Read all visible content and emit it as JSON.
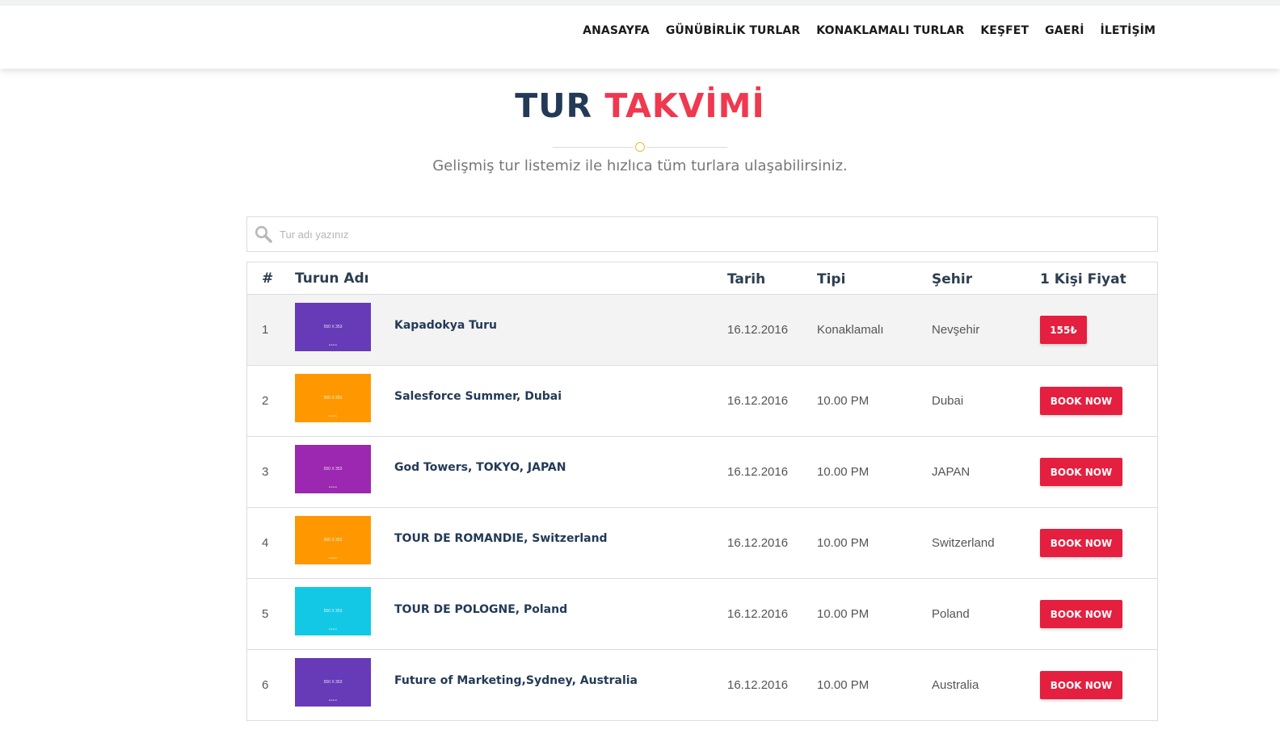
{
  "nav": {
    "items": [
      "ANASAYFA",
      "GÜNÜBİRLİK TURLAR",
      "KONAKLAMALI TURLAR",
      "KEŞFET",
      "GAERİ",
      "İLETİŞİM"
    ]
  },
  "heading": {
    "title_dark": "TUR",
    "title_accent": "TAKVİMİ",
    "subtitle": "Gelişmiş tur listemiz ile hızlıca tüm turlara ulaşabilirsiniz."
  },
  "search": {
    "placeholder": "Tur adı yazınız",
    "icon": "search-icon"
  },
  "table": {
    "headers": {
      "num": "#",
      "name": "Turun Adı",
      "date": "Tarih",
      "type": "Tipi",
      "city": "Şehir",
      "price": "1 Kişi Fiyat"
    },
    "thumb_label": "550 X 353",
    "rows": [
      {
        "num": "1",
        "name": "Kapadokya Turu",
        "date": "16.12.2016",
        "type": "Konaklamalı",
        "city": "Nevşehir",
        "action": "155₺",
        "thumb_color": "#673ab7"
      },
      {
        "num": "2",
        "name": "Salesforce Summer, Dubai",
        "date": "16.12.2016",
        "type": "10.00 PM",
        "city": "Dubai",
        "action": "BOOK NOW",
        "thumb_color": "#ff9800"
      },
      {
        "num": "3",
        "name": "God Towers, TOKYO, JAPAN",
        "date": "16.12.2016",
        "type": "10.00 PM",
        "city": "JAPAN",
        "action": "BOOK NOW",
        "thumb_color": "#9c27b0"
      },
      {
        "num": "4",
        "name": "TOUR DE ROMANDIE, Switzerland",
        "date": "16.12.2016",
        "type": "10.00 PM",
        "city": "Switzerland",
        "action": "BOOK NOW",
        "thumb_color": "#ff9800"
      },
      {
        "num": "5",
        "name": "TOUR DE POLOGNE, Poland",
        "date": "16.12.2016",
        "type": "10.00 PM",
        "city": "Poland",
        "action": "BOOK NOW",
        "thumb_color": "#13c8e4"
      },
      {
        "num": "6",
        "name": "Future of Marketing,Sydney, Australia",
        "date": "16.12.2016",
        "type": "10.00 PM",
        "city": "Australia",
        "action": "BOOK NOW",
        "thumb_color": "#673ab7"
      }
    ]
  },
  "colors": {
    "accent": "#e51f3f",
    "title_dark": "#233a56",
    "title_accent": "#f0384f",
    "divider_dot": "#f3b92a"
  }
}
